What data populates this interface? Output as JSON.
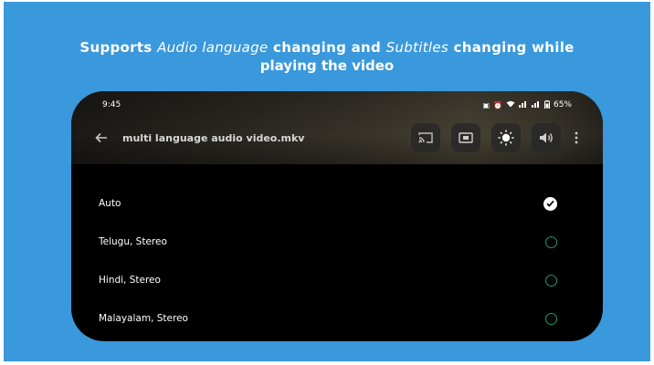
{
  "headline": {
    "line1_a": "Supports ",
    "line1_b": "Audio language",
    "line1_c": " changing and ",
    "line1_d": "Subtitles",
    "line1_e": " changing while",
    "line2": "playing the video"
  },
  "status": {
    "time": "9:45",
    "battery": "65%"
  },
  "toolbar": {
    "title": "multi language audio video.mkv"
  },
  "audio_tracks": [
    {
      "label": "Auto",
      "selected": true
    },
    {
      "label": "Telugu, Stereo",
      "selected": false
    },
    {
      "label": "Hindi, Stereo",
      "selected": false
    },
    {
      "label": "Malayalam, Stereo",
      "selected": false
    }
  ],
  "colors": {
    "background": "#3a98dc",
    "radio_accent": "#1a9a76"
  }
}
